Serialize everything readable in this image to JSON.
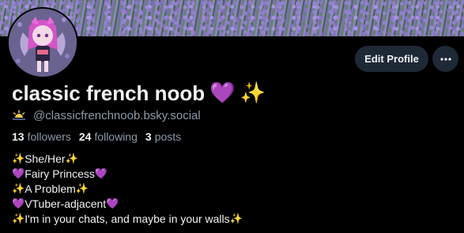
{
  "profile": {
    "display_name": "classic french noob",
    "name_emoji_1": "💜",
    "name_emoji_2": "✨",
    "handle": "@classicfrenchnoob.bsky.social",
    "handle_icon": "sunset-icon"
  },
  "actions": {
    "edit_profile_label": "Edit Profile",
    "more_label": "···"
  },
  "stats": {
    "followers_count": "13",
    "followers_label": "followers",
    "following_count": "24",
    "following_label": "following",
    "posts_count": "3",
    "posts_label": "posts"
  },
  "bio": {
    "lines": [
      {
        "pre": "✨",
        "text": "She/Her",
        "post": "✨"
      },
      {
        "pre": "💜",
        "text": "Fairy Princess",
        "post": "💜"
      },
      {
        "pre": "✨",
        "text": "A Problem",
        "post": "✨"
      },
      {
        "pre": "💜",
        "text": "VTuber-adjacent",
        "post": "💜"
      },
      {
        "pre": "✨",
        "text": "I'm in your chats, and maybe in your walls",
        "post": "✨"
      }
    ]
  },
  "colors": {
    "background": "#000000",
    "button_bg": "#1e2937",
    "muted_text": "#8d9aaa",
    "heart": "#9b6ad6",
    "sparkle": "#f2c94c"
  }
}
